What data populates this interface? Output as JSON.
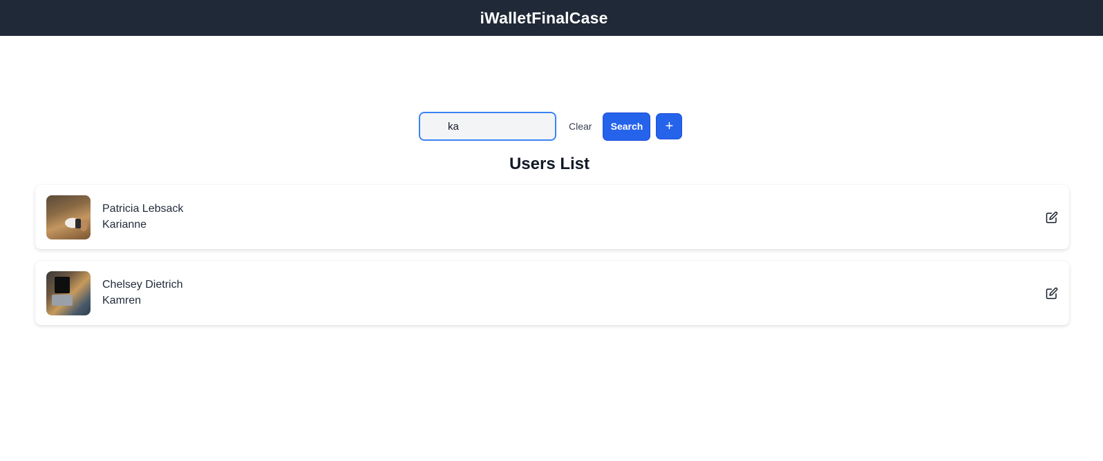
{
  "header": {
    "title": "iWalletFinalCase"
  },
  "search": {
    "value": "ka",
    "clear_label": "Clear",
    "search_label": "Search",
    "add_label": "+"
  },
  "list": {
    "title": "Users List",
    "users": [
      {
        "name": "Patricia Lebsack",
        "username": "Karianne",
        "avatar": "desk-laptop-photo"
      },
      {
        "name": "Chelsey Dietrich",
        "username": "Kamren",
        "avatar": "laptop-user-photo"
      }
    ]
  },
  "colors": {
    "header_bg": "#1f2937",
    "accent": "#2563eb",
    "input_border": "#3b82f6",
    "input_bg": "#f3f4f6"
  },
  "icons": {
    "edit": "edit-pencil-icon",
    "add": "plus-icon"
  }
}
